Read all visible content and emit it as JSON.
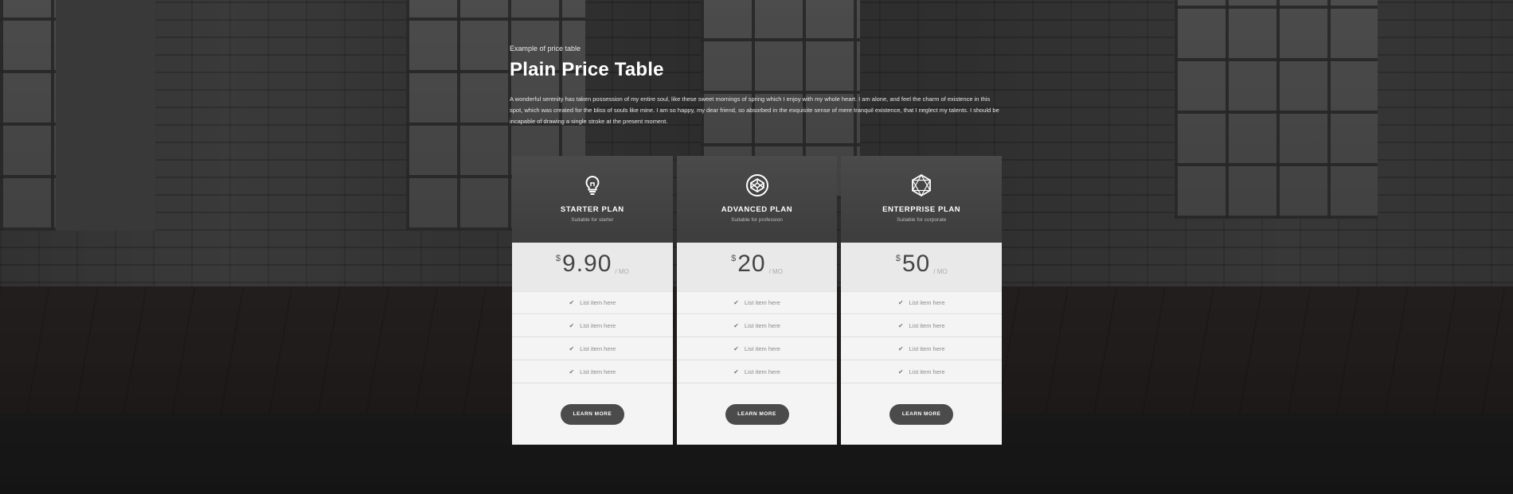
{
  "header": {
    "eyebrow": "Example of price table",
    "title": "Plain Price Table",
    "intro": "A wonderful serenity has taken possession of my entire soul, like these sweet mornings of spring which I enjoy with my whole heart. I am alone, and feel the charm of existence in this spot, which was created for the bliss of souls like mine. I am so happy, my dear friend, so absorbed in the exquisite sense of mere tranquil existence, that I neglect my talents. I should be incapable of drawing a single stroke at the present moment."
  },
  "plans": [
    {
      "icon": "lightbulb-icon",
      "name": "STARTER PLAN",
      "subtitle": "Suitable for starter",
      "currency": "$",
      "amount": "9.90",
      "period": "/ MO",
      "features": [
        "List item here",
        "List item here",
        "List item here",
        "List item here"
      ],
      "cta": "LEARN MORE"
    },
    {
      "icon": "codepen-icon",
      "name": "ADVANCED PLAN",
      "subtitle": "Suitable for profession",
      "currency": "$",
      "amount": "20",
      "period": "/ MO",
      "features": [
        "List item here",
        "List item here",
        "List item here",
        "List item here"
      ],
      "cta": "LEARN MORE"
    },
    {
      "icon": "geometric-polygon-icon",
      "name": "ENTERPRISE PLAN",
      "subtitle": "Suitable for corporate",
      "currency": "$",
      "amount": "50",
      "period": "/ MO",
      "features": [
        "List item here",
        "List item here",
        "List item here",
        "List item here"
      ],
      "cta": "LEARN MORE"
    }
  ],
  "colors": {
    "header_bg": "#4a4a4a",
    "price_bg": "#e9e9e9",
    "body_bg": "#f4f4f4",
    "button_bg": "#4b4b4b"
  }
}
